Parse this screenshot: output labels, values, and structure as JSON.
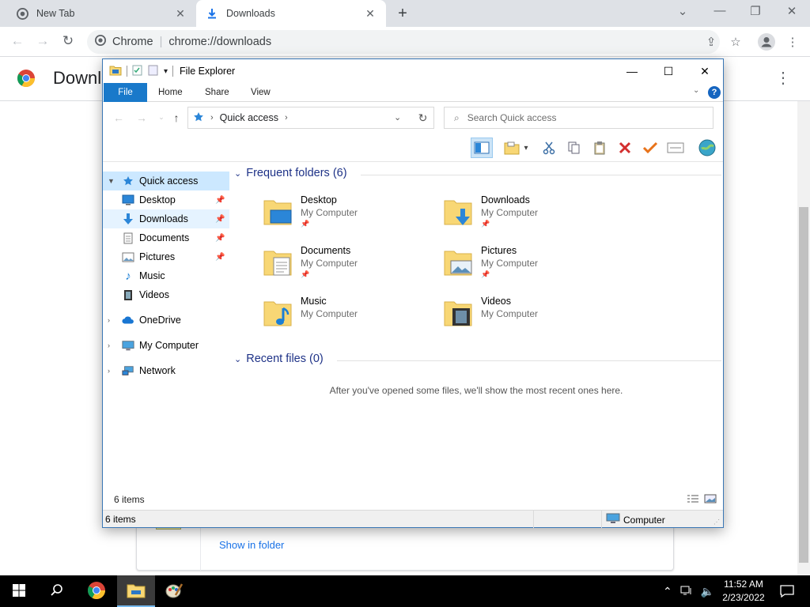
{
  "chrome": {
    "tabs": [
      {
        "label": "New Tab",
        "active": false
      },
      {
        "label": "Downloads",
        "active": true
      }
    ],
    "site_label": "Chrome",
    "url": "chrome://downloads",
    "page_title": "Downl",
    "show_in_folder": "Show in folder"
  },
  "explorer": {
    "title": "File Explorer",
    "ribbon_tabs": [
      "File",
      "Home",
      "Share",
      "View"
    ],
    "address": "Quick access",
    "search_placeholder": "Search Quick access",
    "nav": [
      {
        "label": "Quick access",
        "icon": "star-icon"
      },
      {
        "label": "Desktop",
        "icon": "desktop-icon"
      },
      {
        "label": "Downloads",
        "icon": "download-arrow-icon"
      },
      {
        "label": "Documents",
        "icon": "document-icon"
      },
      {
        "label": "Pictures",
        "icon": "pictures-icon"
      },
      {
        "label": "Music",
        "icon": "music-note-icon"
      },
      {
        "label": "Videos",
        "icon": "film-icon"
      },
      {
        "label": "OneDrive",
        "icon": "cloud-icon"
      },
      {
        "label": "My Computer",
        "icon": "computer-icon"
      },
      {
        "label": "Network",
        "icon": "network-icon"
      }
    ],
    "frequent_header": "Frequent folders (6)",
    "folders": [
      {
        "name": "Desktop",
        "location": "My Computer"
      },
      {
        "name": "Downloads",
        "location": "My Computer"
      },
      {
        "name": "Documents",
        "location": "My Computer"
      },
      {
        "name": "Pictures",
        "location": "My Computer"
      },
      {
        "name": "Music",
        "location": "My Computer"
      },
      {
        "name": "Videos",
        "location": "My Computer"
      }
    ],
    "recent_header": "Recent files (0)",
    "recent_empty_message": "After you've opened some files, we'll show the most recent ones here.",
    "item_count": "6 items",
    "status_count": "6 items",
    "status_location": "Computer"
  },
  "taskbar": {
    "time": "11:52 AM",
    "date": "2/23/2022"
  },
  "colors": {
    "explorer_accent": "#1979ca",
    "group_header": "#1e3287",
    "folder_yellow": "#f8d775",
    "taskbar": "#000000"
  }
}
